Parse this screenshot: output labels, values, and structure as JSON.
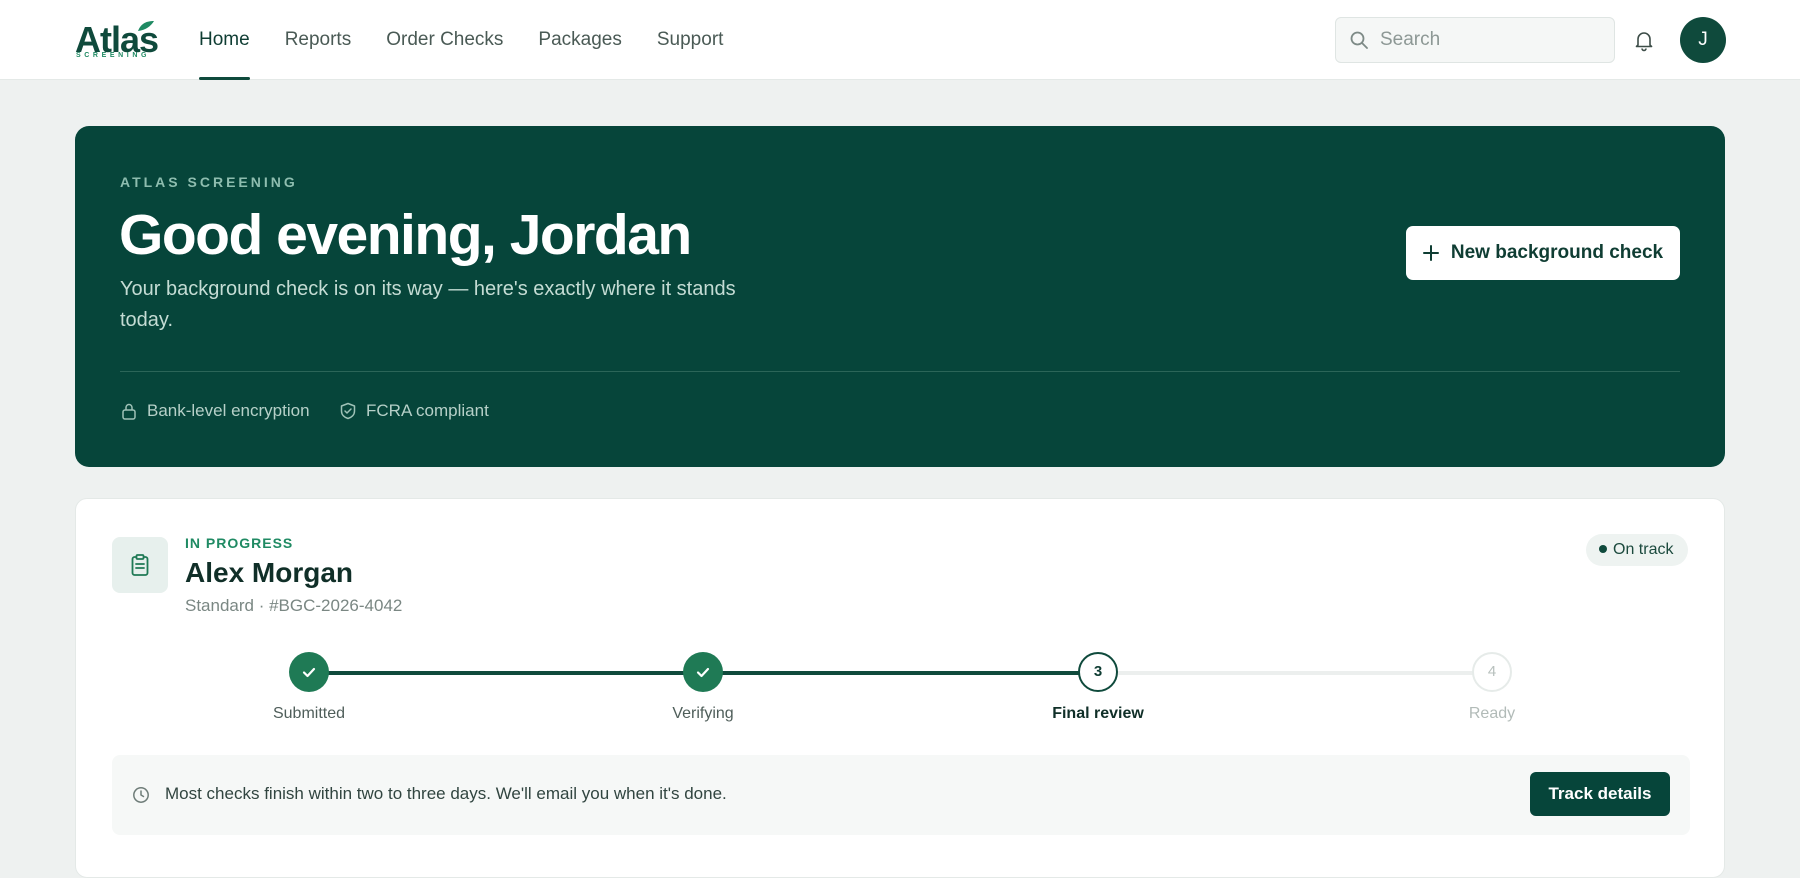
{
  "header": {
    "logo_text": "Atlas",
    "logo_subtext": "SCREENING",
    "nav": [
      {
        "label": "Home",
        "active": true
      },
      {
        "label": "Reports",
        "active": false
      },
      {
        "label": "Order Checks",
        "active": false
      },
      {
        "label": "Packages",
        "active": false
      },
      {
        "label": "Support",
        "active": false
      }
    ],
    "search_placeholder": "Search",
    "avatar_initial": "J"
  },
  "hero": {
    "eyebrow": "ATLAS SCREENING",
    "greeting": "Good evening, Jordan",
    "subtitle": "Your background check is on its way — here's exactly where it stands today.",
    "cta_label": "New background check",
    "trust": [
      {
        "icon": "lock-icon",
        "label": "Bank-level encryption"
      },
      {
        "icon": "shield-check-icon",
        "label": "FCRA compliant"
      }
    ]
  },
  "check": {
    "status_label": "IN PROGRESS",
    "candidate_name": "Alex Morgan",
    "meta": "Standard · #BGC-2026-4042",
    "badge": "On track",
    "steps": [
      {
        "label": "Submitted",
        "state": "done",
        "number": "1"
      },
      {
        "label": "Verifying",
        "state": "done",
        "number": "2"
      },
      {
        "label": "Final review",
        "state": "current",
        "number": "3"
      },
      {
        "label": "Ready",
        "state": "upcoming",
        "number": "4"
      }
    ],
    "notice": "Most checks finish within two to three days. We'll email you when it's done.",
    "track_button": "Track details"
  },
  "colors": {
    "brand_dark": "#06453a",
    "accent_green": "#1f8a63",
    "done_step": "#1f7a55",
    "page_bg": "#eef1f0"
  }
}
